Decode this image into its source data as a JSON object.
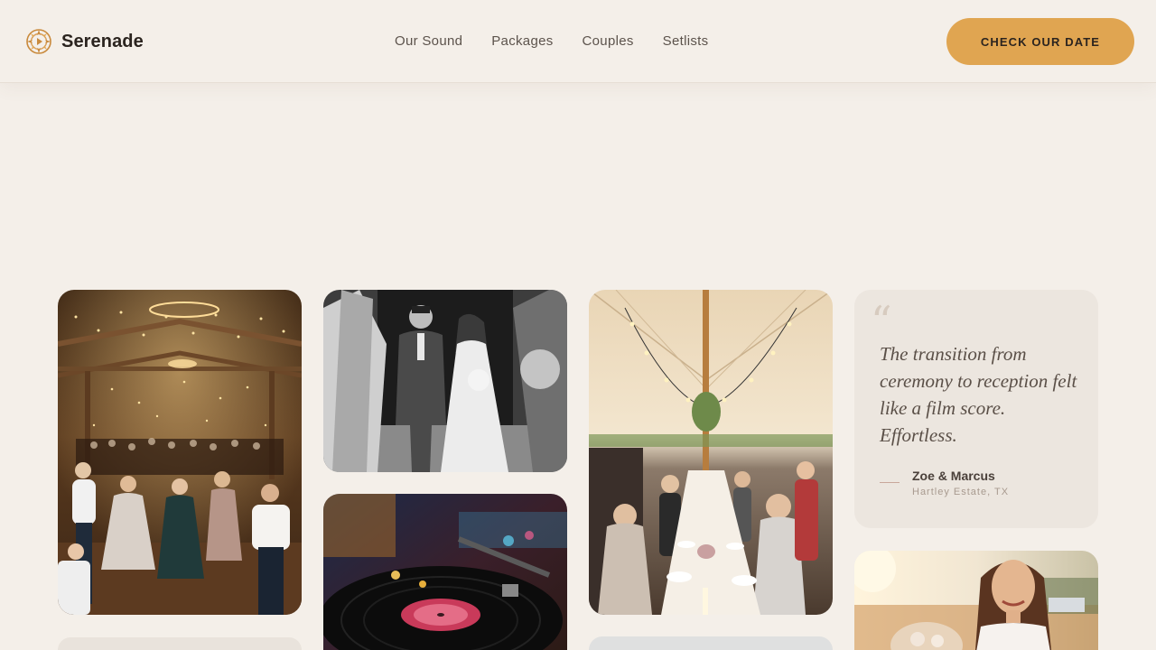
{
  "brand": {
    "name": "Serenade",
    "icon": "sun-ornament-icon"
  },
  "nav": {
    "items": [
      {
        "label": "Our Sound"
      },
      {
        "label": "Packages"
      },
      {
        "label": "Couples"
      },
      {
        "label": "Setlists"
      }
    ]
  },
  "cta": {
    "label": "CHECK OUR DATE"
  },
  "testimonial": {
    "quote_glyph": "“",
    "quote": "The transition from ceremony to reception felt like a film score. Effortless.",
    "name": "Zoe & Marcus",
    "place": "Hartley Estate, TX"
  },
  "gallery": {
    "images": [
      {
        "subject": "barn reception dance floor with string lights"
      },
      {
        "subject": "black and white bride and groom exit"
      },
      {
        "subject": "vinyl record on turntable"
      },
      {
        "subject": "tent reception dinner with long table"
      },
      {
        "subject": "smiling bride with bouquet outdoors"
      }
    ]
  },
  "colors": {
    "background": "#f4efe9",
    "accent": "#e0a551",
    "text": "#2b241f",
    "muted": "#5c534c"
  }
}
